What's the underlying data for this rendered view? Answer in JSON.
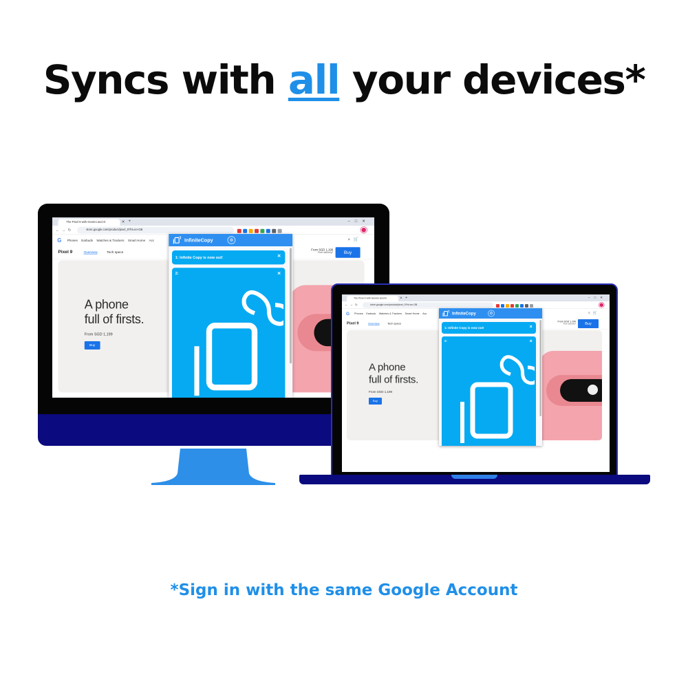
{
  "headline": {
    "pre": "Syncs with ",
    "highlight": "all",
    "post": " your devices*"
  },
  "footnote": "*Sign in with the same Google Account",
  "colors": {
    "accent": "#1f8fe8",
    "device_blue": "#0b0a7e",
    "popup_blue": "#2e8ff0",
    "clip_blue": "#06aaf2"
  },
  "browser": {
    "tab_title": "The Pixel 9 with Gemini and Al",
    "url": "store.google.com/product/pixel_9?hl=en-GB",
    "nav": [
      "Phones",
      "Earbuds",
      "Watches & Trackers",
      "Smart Home",
      "Acc"
    ],
    "product": {
      "name": "Pixel 9",
      "tab_overview": "Overview",
      "tab_techspecs": "Tech specs",
      "price": "From SGD 1,199",
      "delivery": "Free delivery¹",
      "buy": "Buy"
    },
    "hero": {
      "line1": "A phone",
      "line2": "full of firsts.",
      "price": "From SGD 1,199",
      "buy": "Buy"
    }
  },
  "extension": {
    "name": "InfiniteCopy",
    "clip1": "1: Infinite Copy is now out!",
    "clip2": "2:",
    "close": "✕"
  }
}
